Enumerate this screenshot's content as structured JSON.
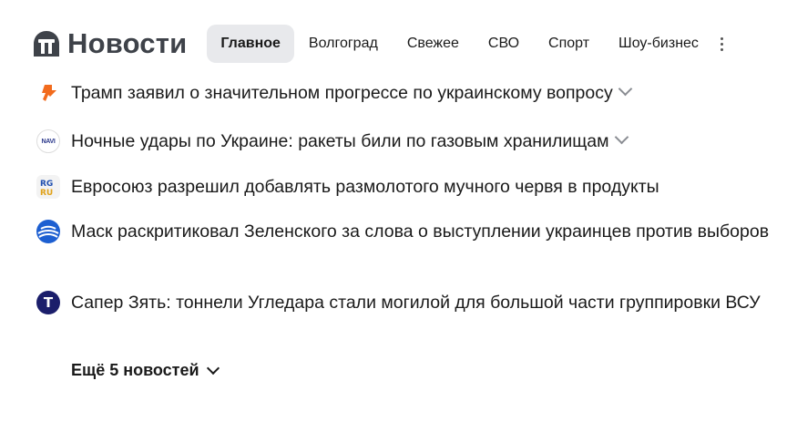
{
  "brand": {
    "title": "Новости",
    "icon": "yandex-news-icon",
    "color": "#3e4249"
  },
  "nav": {
    "tabs": [
      {
        "label": "Главное",
        "active": true
      },
      {
        "label": "Волгоград",
        "active": false
      },
      {
        "label": "Свежее",
        "active": false
      },
      {
        "label": "СВО",
        "active": false
      },
      {
        "label": "Спорт",
        "active": false
      },
      {
        "label": "Шоу-бизнес",
        "active": false
      }
    ],
    "more_icon": "kebab-menu-icon"
  },
  "news": [
    {
      "title": "Трамп заявил о значительном прогрессе по украинскому вопросу",
      "source_icon": "ria-novosti-icon",
      "expandable": true
    },
    {
      "title": "Ночные удары по Украине: ракеты били по газовым хранилищам",
      "source_icon": "navigator-icon",
      "source_icon_text": "NAVI",
      "expandable": true
    },
    {
      "title": "Евросоюз разрешил добавлять размолотого мучного червя в продукты",
      "source_icon": "rg-icon",
      "source_icon_text": "RG RU",
      "expandable": false
    },
    {
      "title": "Маск раскритиковал Зеленского за слова о выступлении украинцев против выборов",
      "source_icon": "globe-icon",
      "expandable": false
    },
    {
      "title": "Сапер Зять: тоннели Угледара стали могилой для большой части группировки ВСУ",
      "source_icon": "t-letter-icon",
      "source_icon_text": "T",
      "expandable": false
    }
  ],
  "more": {
    "label": "Ещё 5 новостей",
    "icon": "chevron-down-icon"
  },
  "colors": {
    "active_tab_bg": "#e8e9ec",
    "text": "#1a1a1a",
    "ria_orange": "#f26b1d",
    "globe_blue": "#1d5fd1",
    "t_navy": "#1b1e6b"
  }
}
